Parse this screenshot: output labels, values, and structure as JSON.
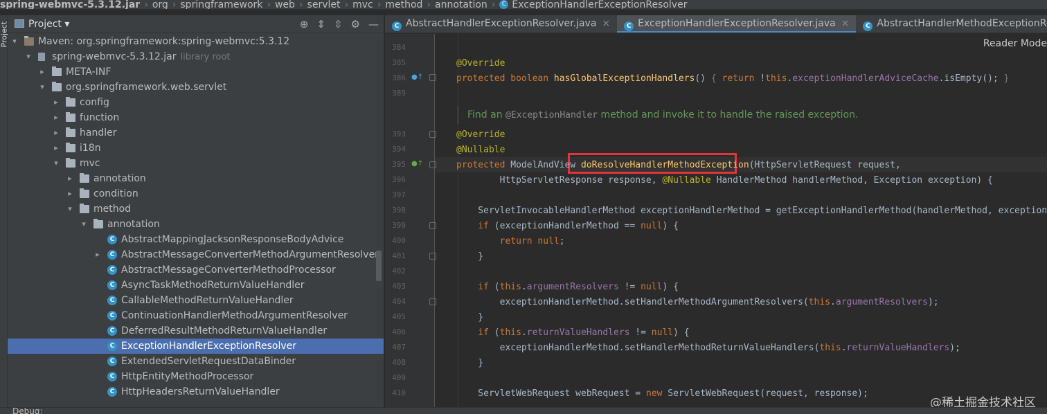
{
  "breadcrumb": {
    "items": [
      "spring-webmvc-5.3.12.jar",
      "org",
      "springframework",
      "web",
      "servlet",
      "mvc",
      "method",
      "annotation"
    ],
    "current": "ExceptionHandlerExceptionResolver"
  },
  "left_strip": {
    "label": "Project"
  },
  "project_panel": {
    "title": "Project",
    "tools": [
      "target-icon",
      "expand-icon",
      "collapse-icon",
      "gear-icon",
      "minimize-icon"
    ],
    "tree": [
      {
        "label": "Maven: org.springframework:spring-webmvc:5.3.12",
        "dim": "",
        "depth": 1,
        "arrow": "open",
        "icon": "maven"
      },
      {
        "label": "spring-webmvc-5.3.12.jar",
        "dim": "library root",
        "depth": 2,
        "arrow": "open",
        "icon": "jar"
      },
      {
        "label": "META-INF",
        "dim": "",
        "depth": 3,
        "arrow": "closed",
        "icon": "folder"
      },
      {
        "label": "org.springframework.web.servlet",
        "dim": "",
        "depth": 3,
        "arrow": "open",
        "icon": "folder"
      },
      {
        "label": "config",
        "dim": "",
        "depth": 4,
        "arrow": "closed",
        "icon": "folder"
      },
      {
        "label": "function",
        "dim": "",
        "depth": 4,
        "arrow": "closed",
        "icon": "folder"
      },
      {
        "label": "handler",
        "dim": "",
        "depth": 4,
        "arrow": "closed",
        "icon": "folder"
      },
      {
        "label": "i18n",
        "dim": "",
        "depth": 4,
        "arrow": "closed",
        "icon": "folder"
      },
      {
        "label": "mvc",
        "dim": "",
        "depth": 4,
        "arrow": "open",
        "icon": "folder"
      },
      {
        "label": "annotation",
        "dim": "",
        "depth": 5,
        "arrow": "closed",
        "icon": "folder"
      },
      {
        "label": "condition",
        "dim": "",
        "depth": 5,
        "arrow": "closed",
        "icon": "folder"
      },
      {
        "label": "method",
        "dim": "",
        "depth": 5,
        "arrow": "open",
        "icon": "folder"
      },
      {
        "label": "annotation",
        "dim": "",
        "depth": 6,
        "arrow": "open",
        "icon": "folder"
      },
      {
        "label": "AbstractMappingJacksonResponseBodyAdvice",
        "dim": "",
        "depth": 7,
        "arrow": "",
        "icon": "class"
      },
      {
        "label": "AbstractMessageConverterMethodArgumentResolver",
        "dim": "",
        "depth": 7,
        "arrow": "closed",
        "icon": "class"
      },
      {
        "label": "AbstractMessageConverterMethodProcessor",
        "dim": "",
        "depth": 7,
        "arrow": "",
        "icon": "class"
      },
      {
        "label": "AsyncTaskMethodReturnValueHandler",
        "dim": "",
        "depth": 7,
        "arrow": "",
        "icon": "class"
      },
      {
        "label": "CallableMethodReturnValueHandler",
        "dim": "",
        "depth": 7,
        "arrow": "",
        "icon": "class"
      },
      {
        "label": "ContinuationHandlerMethodArgumentResolver",
        "dim": "",
        "depth": 7,
        "arrow": "",
        "icon": "class"
      },
      {
        "label": "DeferredResultMethodReturnValueHandler",
        "dim": "",
        "depth": 7,
        "arrow": "",
        "icon": "class"
      },
      {
        "label": "ExceptionHandlerExceptionResolver",
        "dim": "",
        "depth": 7,
        "arrow": "",
        "icon": "class",
        "selected": true
      },
      {
        "label": "ExtendedServletRequestDataBinder",
        "dim": "",
        "depth": 7,
        "arrow": "",
        "icon": "class"
      },
      {
        "label": "HttpEntityMethodProcessor",
        "dim": "",
        "depth": 7,
        "arrow": "",
        "icon": "class"
      },
      {
        "label": "HttpHeadersReturnValueHandler",
        "dim": "",
        "depth": 7,
        "arrow": "",
        "icon": "class"
      }
    ]
  },
  "editor": {
    "tabs": [
      {
        "label": "AbstractHandlerExceptionResolver.java",
        "active": false,
        "closable": true
      },
      {
        "label": "ExceptionHandlerExceptionResolver.java",
        "active": true,
        "closable": true
      },
      {
        "label": "AbstractHandlerMethodExceptionResolver.java",
        "active": false,
        "closable": false
      }
    ],
    "reader_mode": "Reader Mode",
    "doc_comment": {
      "before": "Find an ",
      "code": "@ExceptionHandler",
      "after": " method and invoke it to handle the raised exception."
    },
    "highlighted_method": "doResolveHandlerMethodException",
    "lines": [
      {
        "n": "384",
        "html": "",
        "gutter": ""
      },
      {
        "n": "385",
        "html": "<span class=\"ann\">@Override</span>",
        "gutter": ""
      },
      {
        "n": "386",
        "html": "<span class=\"kw\">protected boolean </span><span class=\"fn\">hasGlobalExceptionHandlers</span>() <span style=\"color:#777\">{</span> <span class=\"kw\">return</span> !<span class=\"kw\">this</span>.<span class=\"fld\">exceptionHandlerAdviceCache</span>.isEmpty(); <span style=\"color:#777\">}</span>",
        "gutter": "o"
      },
      {
        "n": "389",
        "html": "",
        "gutter": ""
      },
      {
        "n": "393",
        "html": "<span class=\"ann\">@Override</span>",
        "gutter": ""
      },
      {
        "n": "394",
        "html": "<span class=\"ann\">@Nullable</span>",
        "gutter": ""
      },
      {
        "n": "395",
        "html": "<span class=\"kw\">protected </span>ModelAndView <span class=\"fn\">doResolveHandlerMethodException</span>(HttpServletRequest request,",
        "gutter": "g"
      },
      {
        "n": "396",
        "html": "        HttpServletResponse response, <span class=\"ann\">@Nullable</span> HandlerMethod handlerMethod, Exception exception) {",
        "gutter": ""
      },
      {
        "n": "397",
        "html": "",
        "gutter": ""
      },
      {
        "n": "398",
        "html": "    ServletInvocableHandlerMethod exceptionHandlerMethod = getExceptionHandlerMethod(handlerMethod, exception);",
        "gutter": ""
      },
      {
        "n": "399",
        "html": "    <span class=\"kw\">if</span> (exceptionHandlerMethod == <span class=\"kw\">null</span>) {",
        "gutter": ""
      },
      {
        "n": "400",
        "html": "        <span class=\"kw\">return null</span>;",
        "gutter": ""
      },
      {
        "n": "401",
        "html": "    }",
        "gutter": ""
      },
      {
        "n": "402",
        "html": "",
        "gutter": ""
      },
      {
        "n": "403",
        "html": "    <span class=\"kw\">if</span> (<span class=\"kw\">this</span>.<span class=\"fld\">argumentResolvers</span> != <span class=\"kw\">null</span>) {",
        "gutter": ""
      },
      {
        "n": "404",
        "html": "        exceptionHandlerMethod.setHandlerMethodArgumentResolvers(<span class=\"kw\">this</span>.<span class=\"fld\">argumentResolvers</span>);",
        "gutter": ""
      },
      {
        "n": "405",
        "html": "    }",
        "gutter": ""
      },
      {
        "n": "406",
        "html": "    <span class=\"kw\">if</span> (<span class=\"kw\">this</span>.<span class=\"fld\">returnValueHandlers</span> != <span class=\"kw\">null</span>) {",
        "gutter": ""
      },
      {
        "n": "407",
        "html": "        exceptionHandlerMethod.setHandlerMethodReturnValueHandlers(<span class=\"kw\">this</span>.<span class=\"fld\">returnValueHandlers</span>);",
        "gutter": ""
      },
      {
        "n": "408",
        "html": "    }",
        "gutter": ""
      },
      {
        "n": "409",
        "html": "",
        "gutter": ""
      },
      {
        "n": "410",
        "html": "    ServletWebRequest webRequest = <span class=\"kw\">new</span> ServletWebRequest(request, response);",
        "gutter": ""
      }
    ]
  },
  "watermark": "@稀土掘金技术社区",
  "bottom": {
    "label": "Debug:"
  }
}
